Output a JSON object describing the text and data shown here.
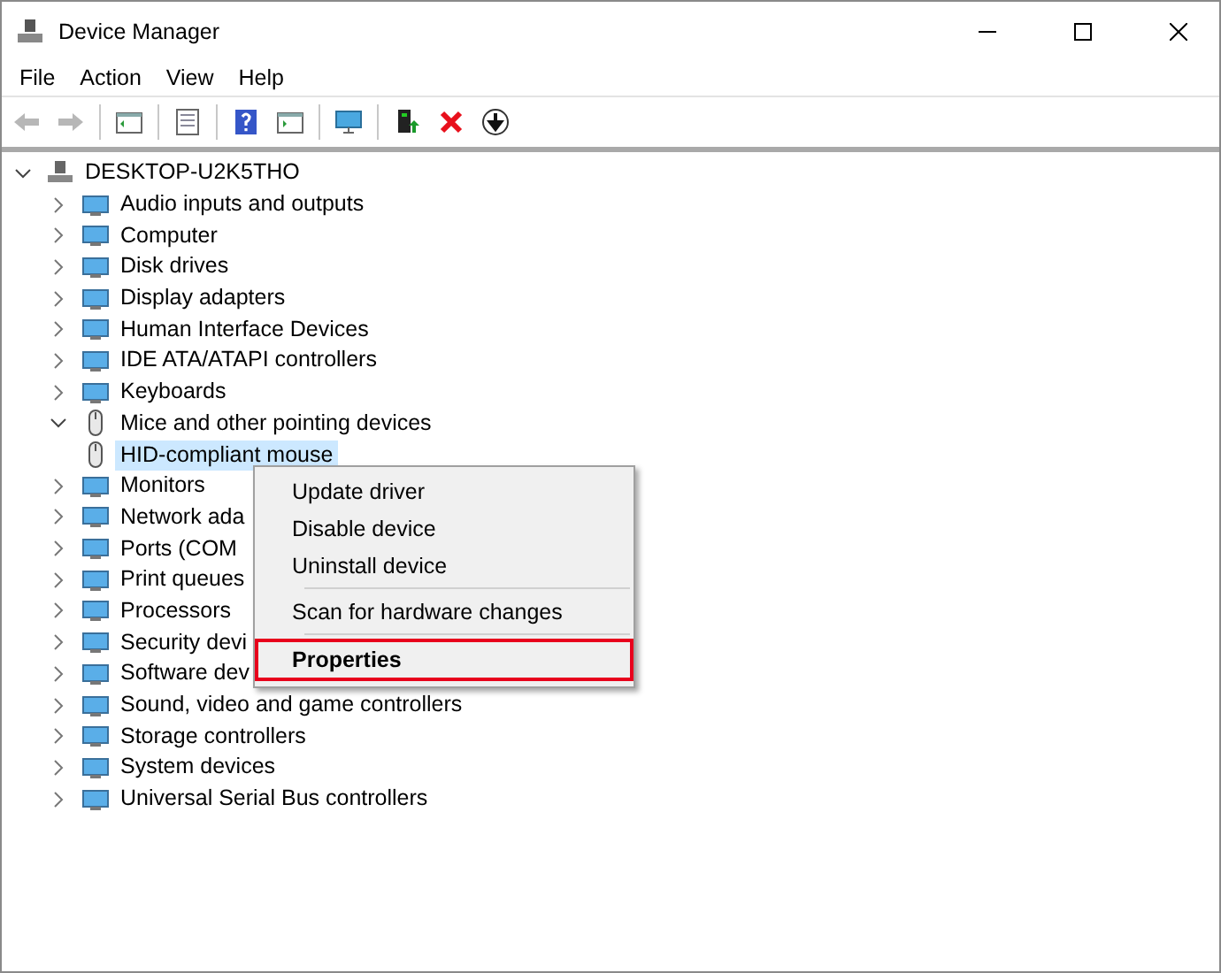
{
  "window": {
    "title": "Device Manager"
  },
  "menu": [
    "File",
    "Action",
    "View",
    "Help"
  ],
  "toolbar": [
    {
      "kind": "back",
      "disabled": true
    },
    {
      "kind": "forward",
      "disabled": true
    },
    {
      "kind": "sep"
    },
    {
      "kind": "panel"
    },
    {
      "kind": "sep"
    },
    {
      "kind": "document"
    },
    {
      "kind": "sep"
    },
    {
      "kind": "help"
    },
    {
      "kind": "panel2"
    },
    {
      "kind": "sep"
    },
    {
      "kind": "monitor"
    },
    {
      "kind": "sep"
    },
    {
      "kind": "update"
    },
    {
      "kind": "remove"
    },
    {
      "kind": "download"
    }
  ],
  "tree": {
    "label": "DESKTOP-U2K5THO",
    "expanded": true,
    "children": [
      {
        "label": "Audio inputs and outputs",
        "expanded": false
      },
      {
        "label": "Computer",
        "expanded": false
      },
      {
        "label": "Disk drives",
        "expanded": false
      },
      {
        "label": "Display adapters",
        "expanded": false
      },
      {
        "label": "Human Interface Devices",
        "expanded": false
      },
      {
        "label": "IDE ATA/ATAPI controllers",
        "expanded": false
      },
      {
        "label": "Keyboards",
        "expanded": false
      },
      {
        "label": "Mice and other pointing devices",
        "expanded": true,
        "children": [
          {
            "label": "HID-compliant mouse",
            "selected": true
          }
        ]
      },
      {
        "label": "Monitors",
        "expanded": false
      },
      {
        "label": "Network ada",
        "expanded": false
      },
      {
        "label": "Ports (COM",
        "expanded": false
      },
      {
        "label": "Print queues",
        "expanded": false
      },
      {
        "label": "Processors",
        "expanded": false
      },
      {
        "label": "Security devi",
        "expanded": false
      },
      {
        "label": "Software dev",
        "expanded": false
      },
      {
        "label": "Sound, video and game controllers",
        "expanded": false
      },
      {
        "label": "Storage controllers",
        "expanded": false
      },
      {
        "label": "System devices",
        "expanded": false
      },
      {
        "label": "Universal Serial Bus controllers",
        "expanded": false
      }
    ]
  },
  "context_menu": [
    {
      "kind": "item",
      "label": "Update driver",
      "bold": false,
      "highlighted": false
    },
    {
      "kind": "item",
      "label": "Disable device",
      "bold": false,
      "highlighted": false
    },
    {
      "kind": "item",
      "label": "Uninstall device",
      "bold": false,
      "highlighted": false
    },
    {
      "kind": "separator"
    },
    {
      "kind": "item",
      "label": "Scan for hardware changes",
      "bold": false,
      "highlighted": false
    },
    {
      "kind": "separator"
    },
    {
      "kind": "item",
      "label": "Properties",
      "bold": true,
      "highlighted": true
    }
  ]
}
